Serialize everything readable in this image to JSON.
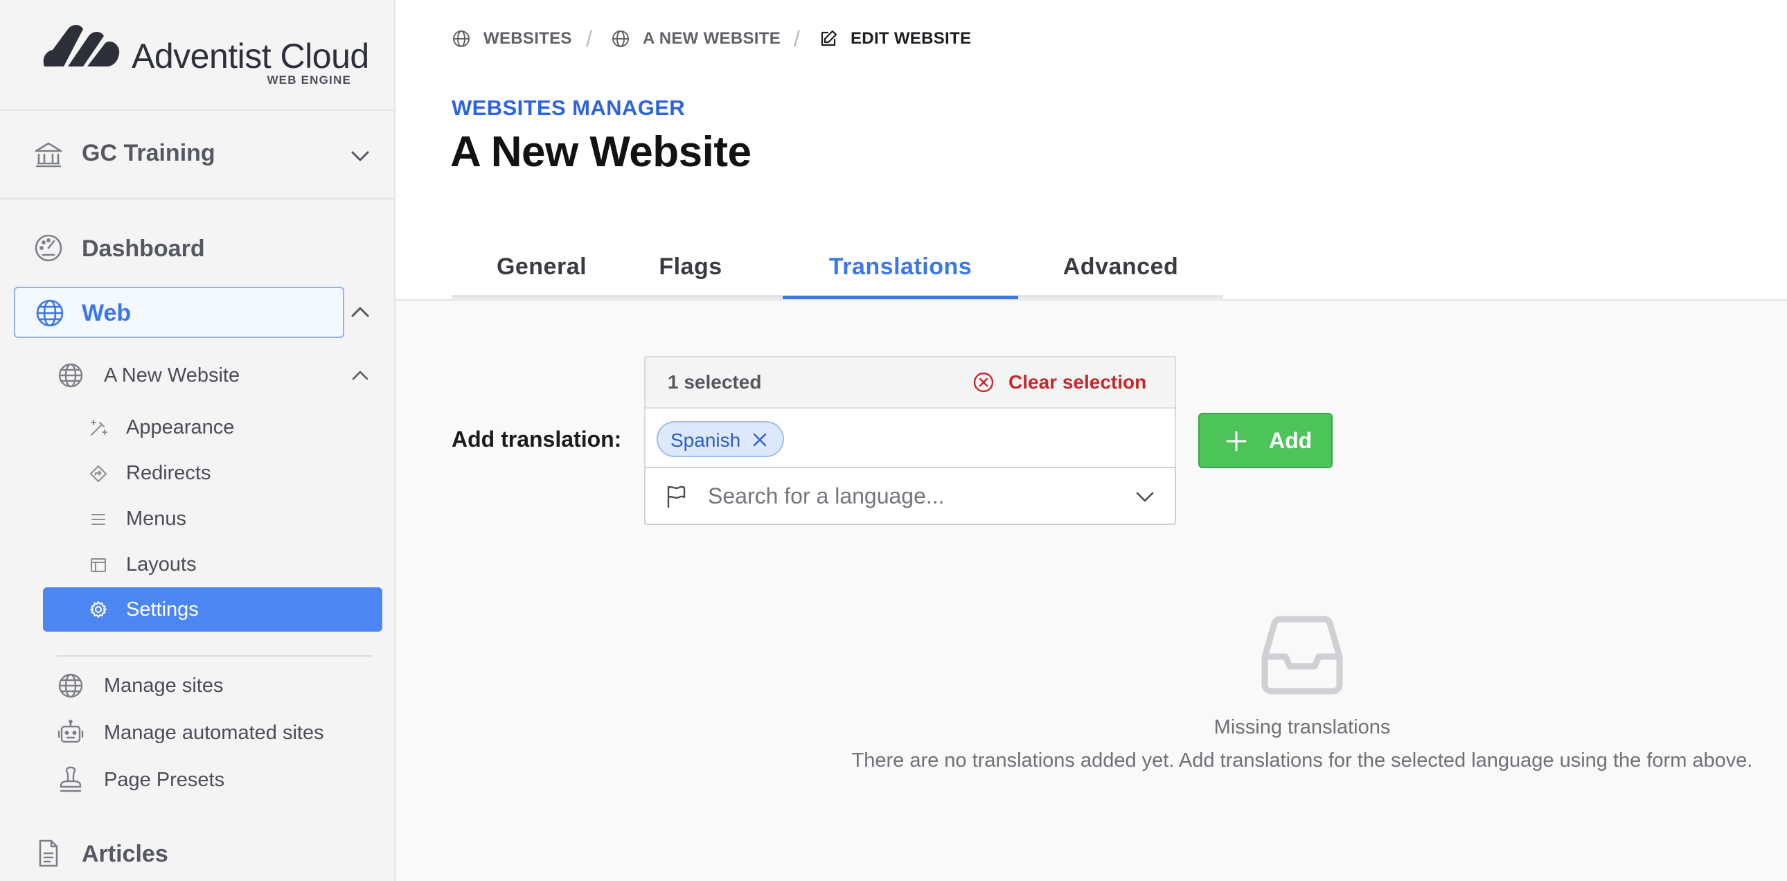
{
  "brand": {
    "name": "Adventist Cloud",
    "tagline": "WEB ENGINE"
  },
  "sidebar": {
    "org": {
      "label": "GC Training"
    },
    "dashboard": "Dashboard",
    "web": "Web",
    "site": "A New Website",
    "site_items": [
      {
        "label": "Appearance",
        "icon": "wand-icon"
      },
      {
        "label": "Redirects",
        "icon": "redirect-icon"
      },
      {
        "label": "Menus",
        "icon": "menu-icon"
      },
      {
        "label": "Layouts",
        "icon": "layout-icon"
      },
      {
        "label": "Settings",
        "icon": "gear-icon"
      }
    ],
    "tools": [
      {
        "label": "Manage sites",
        "icon": "globe-icon"
      },
      {
        "label": "Manage automated sites",
        "icon": "robot-icon"
      },
      {
        "label": "Page Presets",
        "icon": "stamp-icon"
      }
    ],
    "articles": "Articles"
  },
  "breadcrumb": [
    "WEBSITES",
    "A NEW WEBSITE",
    "EDIT WEBSITE"
  ],
  "header": {
    "eyebrow": "WEBSITES MANAGER",
    "title": "A New Website"
  },
  "tabs": [
    {
      "label": "General",
      "active": false
    },
    {
      "label": "Flags",
      "active": false
    },
    {
      "label": "Translations",
      "active": true
    },
    {
      "label": "Advanced",
      "active": false
    }
  ],
  "form": {
    "label": "Add translation:",
    "selected_count": "1 selected",
    "clear_label": "Clear selection",
    "chips": [
      "Spanish"
    ],
    "search_placeholder": "Search for a language...",
    "add_label": "Add"
  },
  "empty": {
    "title": "Missing translations",
    "description": "There are no translations added yet. Add translations for the selected language using the form above."
  },
  "colors": {
    "accent": "#3a77e8",
    "eyebrow": "#2c63e0",
    "danger": "#c8262b",
    "success": "#4cc45a"
  }
}
